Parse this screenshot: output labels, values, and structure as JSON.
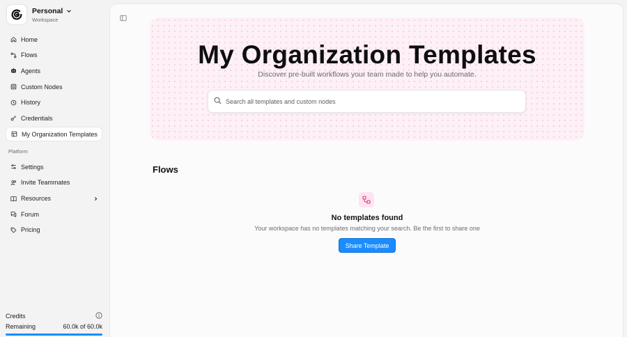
{
  "workspace": {
    "name": "Personal",
    "type": "Workspace"
  },
  "nav": {
    "items": [
      {
        "label": "Home",
        "icon": "home-icon"
      },
      {
        "label": "Flows",
        "icon": "flows-icon"
      },
      {
        "label": "Agents",
        "icon": "agents-icon"
      },
      {
        "label": "Custom Nodes",
        "icon": "custom-nodes-icon"
      },
      {
        "label": "History",
        "icon": "history-icon"
      },
      {
        "label": "Credentials",
        "icon": "key-icon"
      },
      {
        "label": "My Organization Templates",
        "icon": "templates-icon",
        "active": true
      }
    ],
    "platform_label": "Platform",
    "platform_items": [
      {
        "label": "Settings",
        "icon": "settings-icon"
      },
      {
        "label": "Invite Teammates",
        "icon": "users-icon"
      },
      {
        "label": "Resources",
        "icon": "book-icon"
      },
      {
        "label": "Forum",
        "icon": "forum-icon"
      },
      {
        "label": "Pricing",
        "icon": "tag-icon"
      }
    ]
  },
  "credits": {
    "title": "Credits",
    "remaining_label": "Remaining",
    "remaining_value": "60.0k of 60.0k",
    "fraction_remaining": 1.0
  },
  "hero": {
    "title": "My Organization Templates",
    "subtitle": "Discover pre-built workflows your team made to help you automate."
  },
  "search": {
    "placeholder": "Search all templates and custom nodes",
    "value": ""
  },
  "flows_section": {
    "heading": "Flows",
    "empty_title": "No templates found",
    "empty_text": "Your workspace has no templates matching your search. Be the first to share one",
    "button_label": "Share Template"
  },
  "colors": {
    "accent": "#1a8cff",
    "hero_bg": "#fdf0f6",
    "empty_icon": "#e0337f"
  }
}
